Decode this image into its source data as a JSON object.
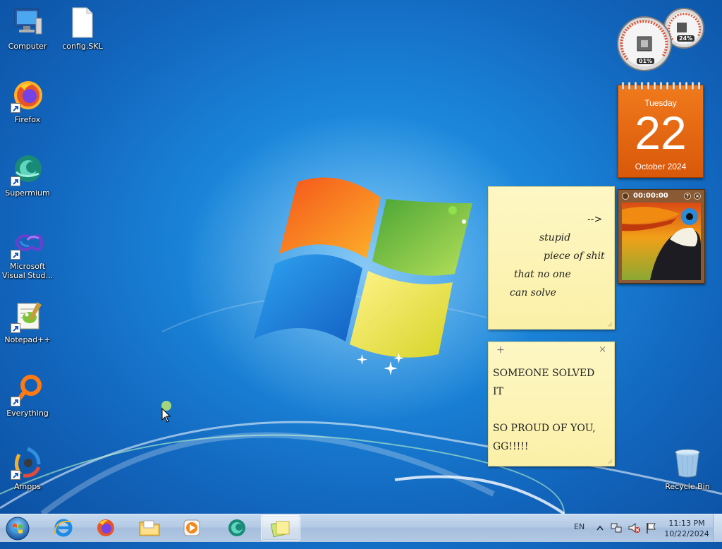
{
  "desktop_icons": [
    {
      "label": "Computer",
      "icon": "computer-icon"
    },
    {
      "label": "config.SKL",
      "icon": "file-icon"
    },
    {
      "label": "Firefox",
      "icon": "firefox-icon",
      "shortcut": true
    },
    {
      "label": "Supermium",
      "icon": "supermium-icon",
      "shortcut": true
    },
    {
      "label": "Microsoft Visual Stud...",
      "icon": "visual-studio-icon",
      "shortcut": true
    },
    {
      "label": "Notepad++",
      "icon": "notepadpp-icon",
      "shortcut": true
    },
    {
      "label": "Everything",
      "icon": "everything-icon",
      "shortcut": true
    },
    {
      "label": "Ampps",
      "icon": "ampps-icon",
      "shortcut": true
    },
    {
      "label": "Recycle Bin",
      "icon": "recycle-bin-icon"
    }
  ],
  "gadgets": {
    "cpu_meter": {
      "cpu_label": "01%",
      "memory_label": "24%",
      "cpu_percent": 1,
      "memory_percent": 24
    },
    "calendar": {
      "weekday": "Tuesday",
      "day": "22",
      "month_year": "October 2024"
    },
    "slideshow": {
      "time": "00:00:00",
      "help_icon": "help-icon",
      "close_icon": "close-icon"
    }
  },
  "sticky_notes": [
    {
      "lines": [
        "-->",
        "stupid",
        "piece of shit",
        "that no one",
        "can solve"
      ]
    },
    {
      "add_symbol": "+",
      "close_symbol": "×",
      "lines": [
        "SOMEONE SOLVED",
        "IT",
        "",
        "SO PROUD OF YOU,",
        "GG!!!!!"
      ]
    }
  ],
  "taskbar": {
    "start_icon": "windows-start-orb",
    "pinned": [
      "internet-explorer-icon",
      "firefox-icon",
      "file-explorer-icon",
      "media-player-icon",
      "supermium-icon",
      "sticky-notes-icon"
    ],
    "active_app": "sticky-notes-icon",
    "language": "EN",
    "tray_icons": [
      "show-hidden-icons-icon",
      "network-icon",
      "volume-muted-icon",
      "action-center-flag-icon"
    ],
    "time": "11:13 PM",
    "date": "10/22/2024"
  },
  "colors": {
    "taskbar": "#b4cae4",
    "calendar": "#e8681a",
    "note": "#fbf3b8",
    "wallpaper": "#1a84d8"
  }
}
